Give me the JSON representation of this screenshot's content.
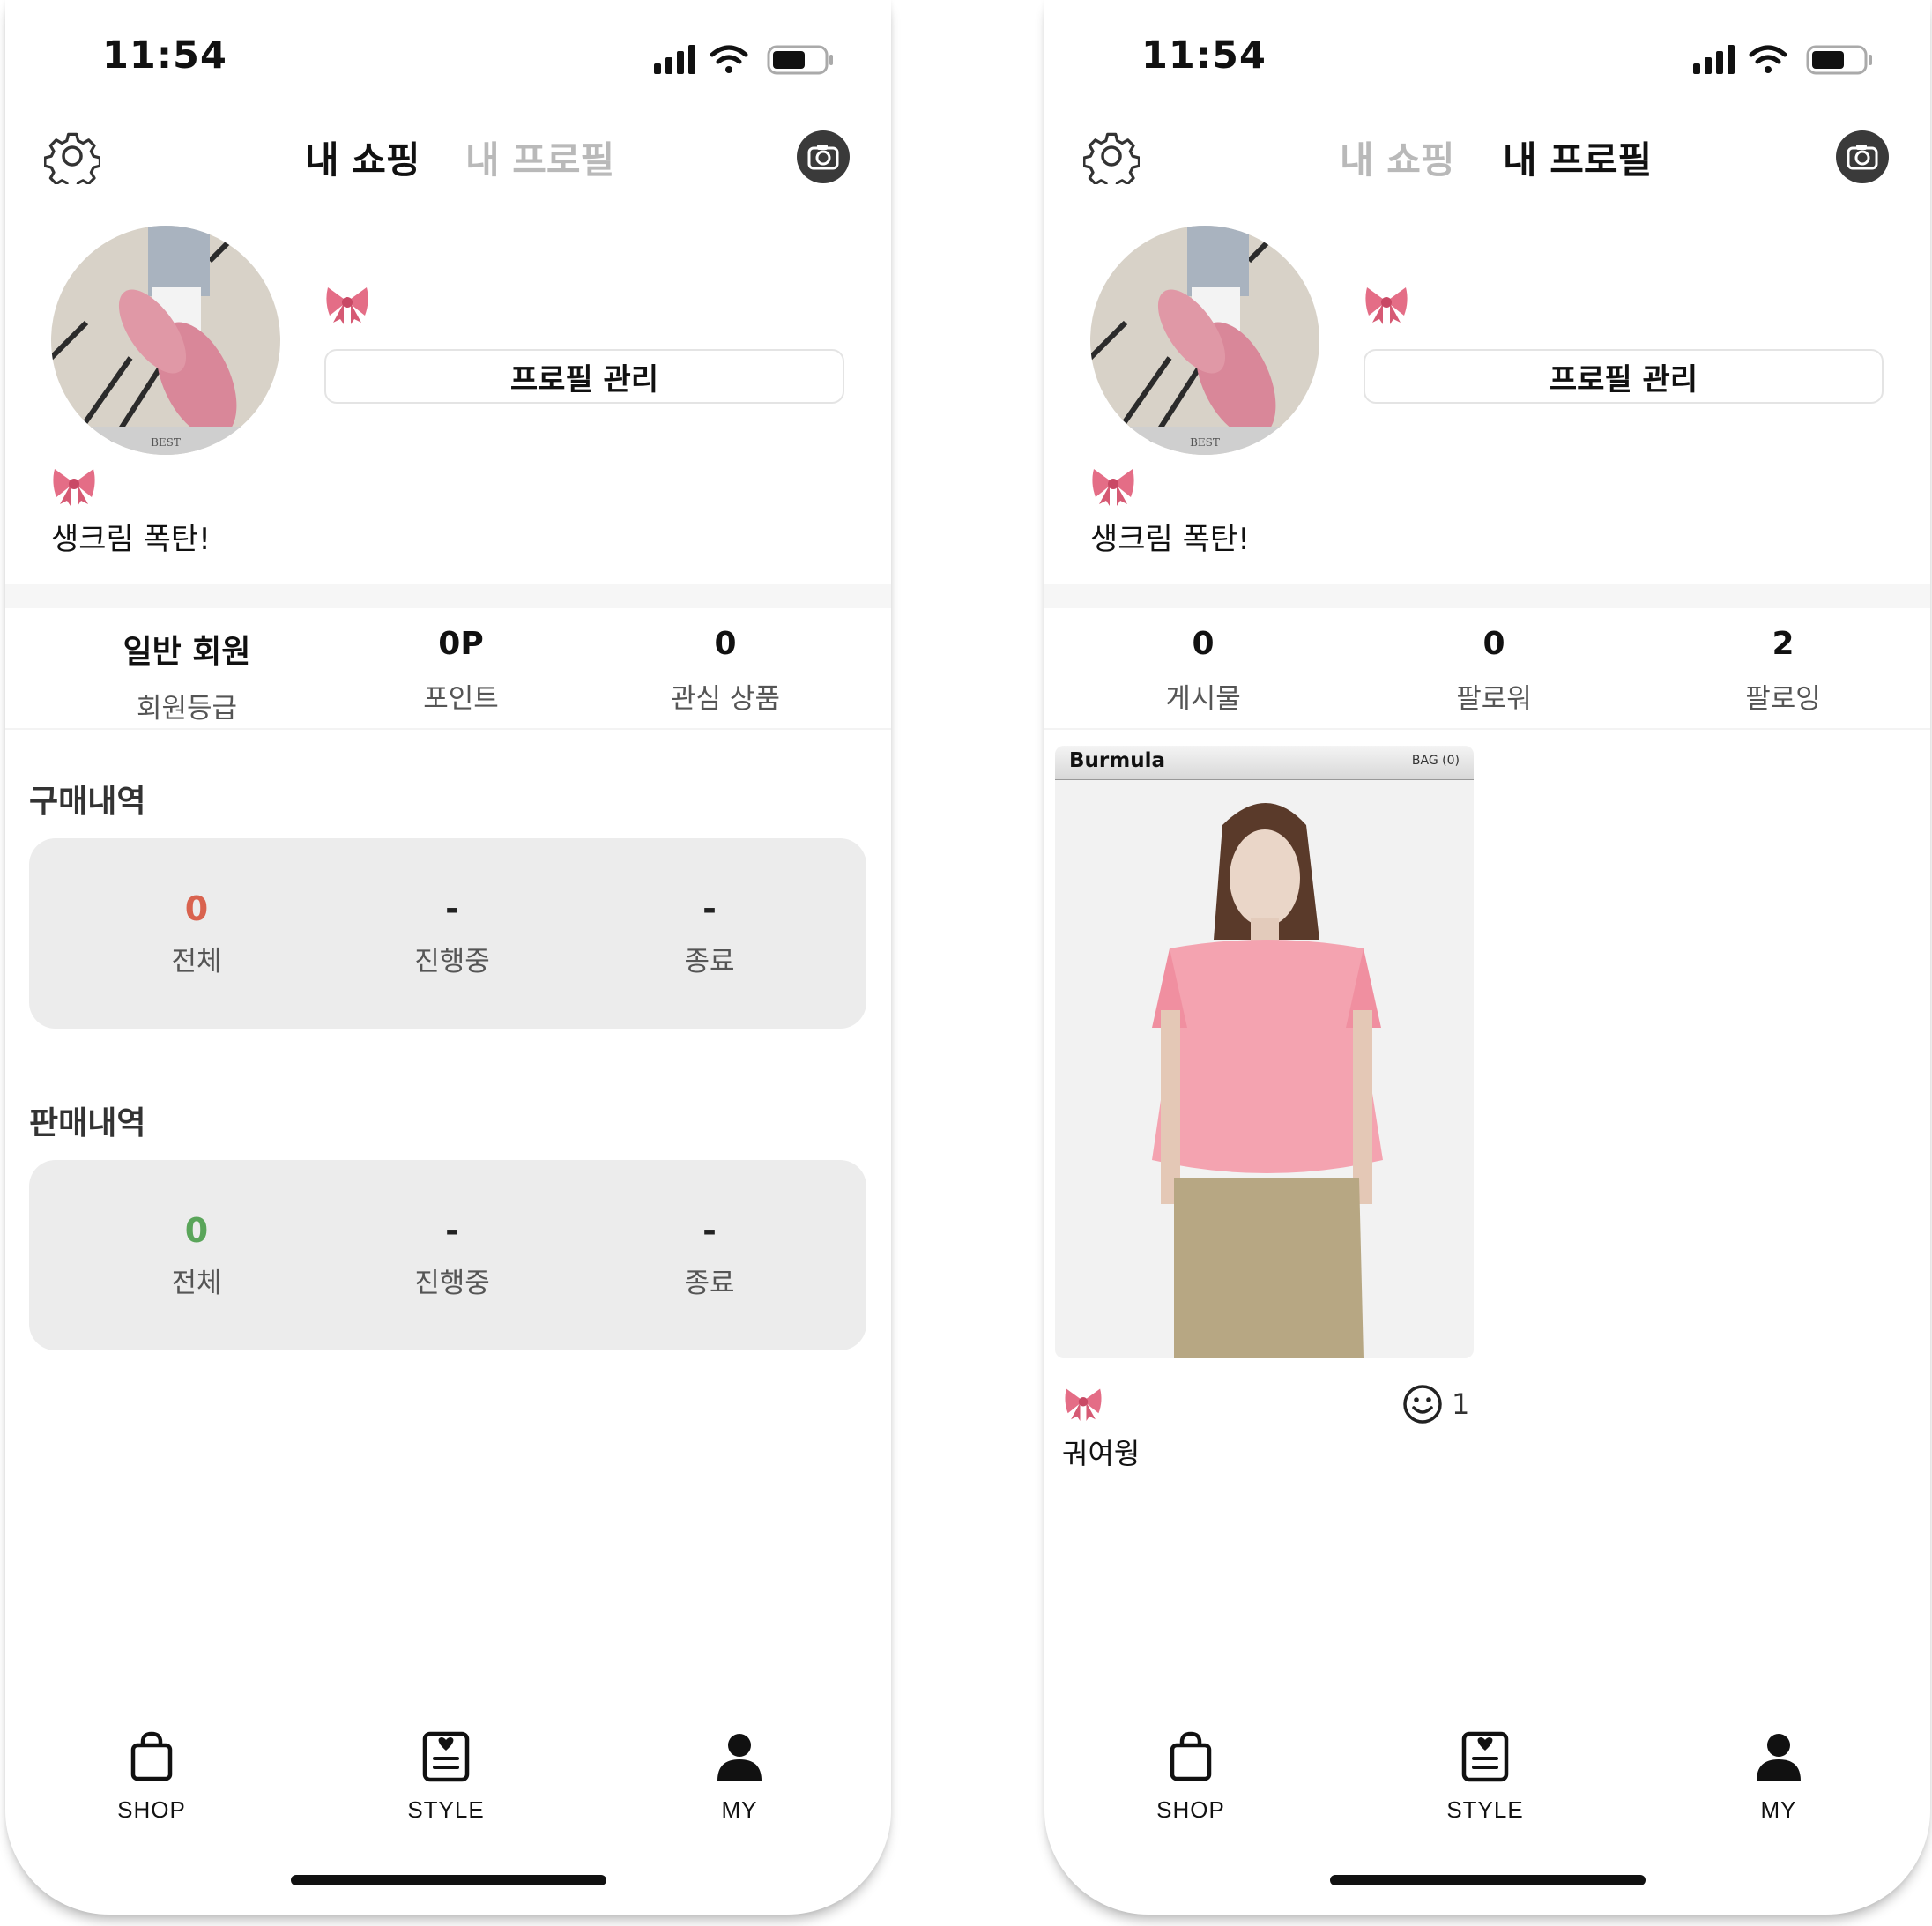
{
  "shared": {
    "time": "11:54",
    "bio": "생크림 폭탄!",
    "profile_button": "프로필 관리",
    "avatar_caption": "BEST",
    "nav": [
      {
        "label": "SHOP",
        "icon": "shopping-bag-icon"
      },
      {
        "label": "STYLE",
        "icon": "style-card-icon"
      },
      {
        "label": "MY",
        "icon": "person-icon"
      }
    ],
    "colors": {
      "inactive_tab": "#b9b9b9",
      "purchase_total": "#d9634f",
      "sales_total": "#5aa55a",
      "box_bg": "#ececec"
    }
  },
  "left": {
    "tabs": [
      {
        "label": "내 쇼핑",
        "active": true
      },
      {
        "label": "내 프로필",
        "active": false
      }
    ],
    "stats": [
      {
        "value": "일반 회원",
        "label": "회원등급"
      },
      {
        "value": "0P",
        "label": "포인트"
      },
      {
        "value": "0",
        "label": "관심 상품"
      }
    ],
    "purchase": {
      "title": "구매내역",
      "items": [
        {
          "value": "0",
          "label": "전체"
        },
        {
          "value": "-",
          "label": "진행중"
        },
        {
          "value": "-",
          "label": "종료"
        }
      ]
    },
    "sales": {
      "title": "판매내역",
      "items": [
        {
          "value": "0",
          "label": "전체"
        },
        {
          "value": "-",
          "label": "진행중"
        },
        {
          "value": "-",
          "label": "종료"
        }
      ]
    }
  },
  "right": {
    "tabs": [
      {
        "label": "내 쇼핑",
        "active": false
      },
      {
        "label": "내 프로필",
        "active": true
      }
    ],
    "stats": [
      {
        "value": "0",
        "label": "게시물"
      },
      {
        "value": "0",
        "label": "팔로워"
      },
      {
        "value": "2",
        "label": "팔로잉"
      }
    ],
    "post": {
      "brand": "Burmula",
      "bag": "BAG (0)",
      "caption": "궈여웡",
      "likes": "1"
    }
  }
}
